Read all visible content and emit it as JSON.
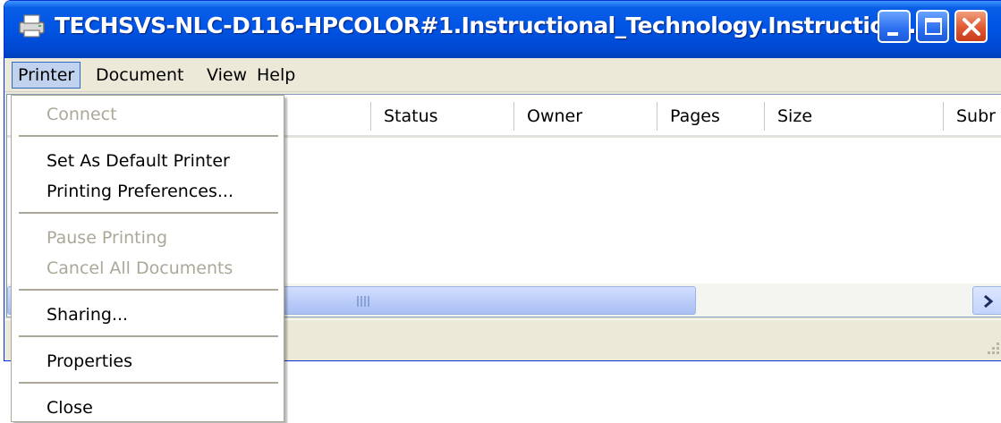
{
  "window": {
    "title": "TECHSVS-NLC-D116-HPCOLOR#1.Instructional_Technology.Instruction....",
    "icon": "printer-icon"
  },
  "menubar": {
    "items": [
      "Printer",
      "Document",
      "View",
      "Help"
    ],
    "active": "Printer"
  },
  "columns": [
    "Status",
    "Owner",
    "Pages",
    "Size",
    "Subr"
  ],
  "printer_menu": {
    "items": [
      {
        "label": "Connect",
        "enabled": false
      },
      {
        "label": "Set As Default Printer",
        "enabled": true
      },
      {
        "label": "Printing Preferences...",
        "enabled": true
      },
      {
        "label": "Pause Printing",
        "enabled": false
      },
      {
        "label": "Cancel All Documents",
        "enabled": false
      },
      {
        "label": "Sharing...",
        "enabled": true
      },
      {
        "label": "Properties",
        "enabled": true
      },
      {
        "label": "Close",
        "enabled": true
      }
    ]
  },
  "colors": {
    "titlebar": "#0055e5",
    "menu_highlight": "#c1d2ee",
    "disabled_text": "#aca899",
    "close_button": "#e05830"
  }
}
